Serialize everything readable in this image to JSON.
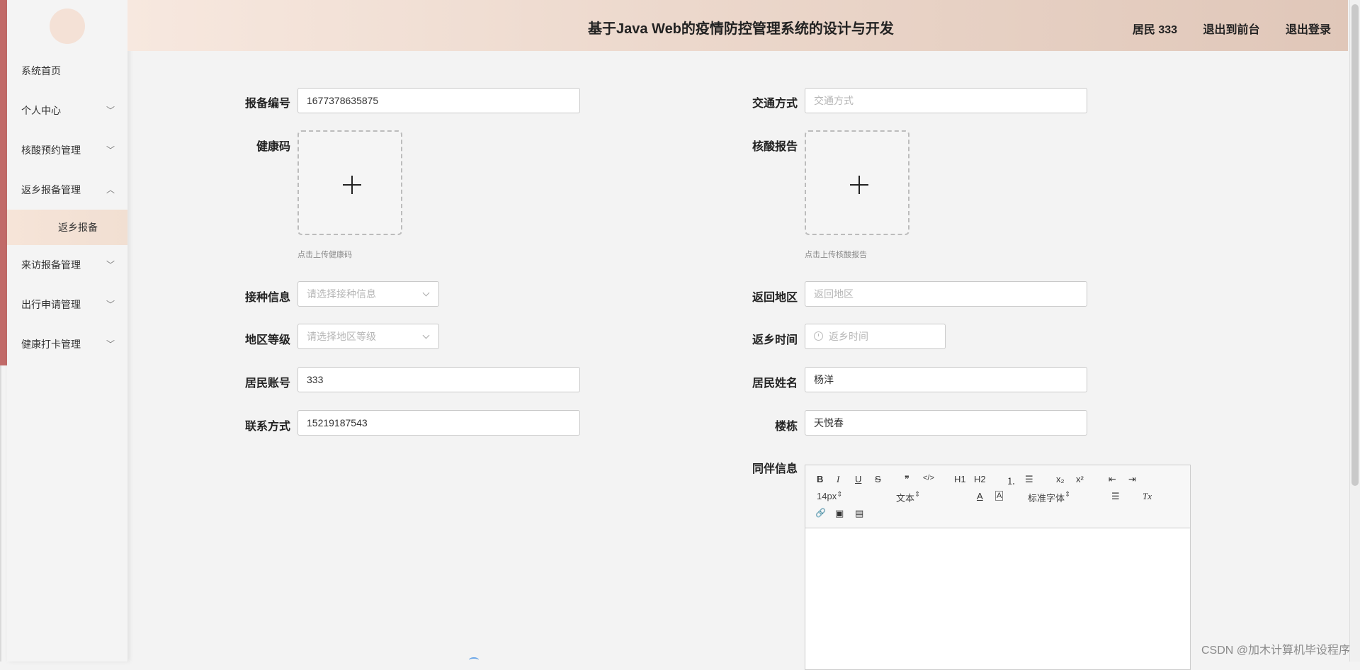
{
  "header": {
    "title": "基于Java Web的疫情防控管理系统的设计与开发",
    "user_label": "居民 333",
    "to_front_label": "退出到前台",
    "logout_label": "退出登录"
  },
  "sidebar": {
    "items": [
      {
        "label": "系统首页"
      },
      {
        "label": "个人中心",
        "chevron": "v"
      },
      {
        "label": "核酸预约管理",
        "chevron": "v"
      },
      {
        "label": "返乡报备管理",
        "chevron": "^",
        "expanded": true
      },
      {
        "label": "来访报备管理",
        "chevron": "v"
      },
      {
        "label": "出行申请管理",
        "chevron": "v"
      },
      {
        "label": "健康打卡管理",
        "chevron": "v"
      }
    ],
    "sub_item": "返乡报备"
  },
  "form": {
    "report_no": {
      "label": "报备编号",
      "value": "1677378635875"
    },
    "transport": {
      "label": "交通方式",
      "placeholder": "交通方式"
    },
    "health_code": {
      "label": "健康码",
      "hint": "点击上传健康码"
    },
    "nucleic_report": {
      "label": "核酸报告",
      "hint": "点击上传核酸报告"
    },
    "vaccination": {
      "label": "接种信息",
      "placeholder": "请选择接种信息"
    },
    "return_region": {
      "label": "返回地区",
      "placeholder": "返回地区"
    },
    "region_level": {
      "label": "地区等级",
      "placeholder": "请选择地区等级"
    },
    "return_time": {
      "label": "返乡时间",
      "placeholder": "返乡时间"
    },
    "resident_account": {
      "label": "居民账号",
      "value": "333"
    },
    "resident_name": {
      "label": "居民姓名",
      "value": "杨洋"
    },
    "contact": {
      "label": "联系方式",
      "value": "15219187543"
    },
    "building": {
      "label": "楼栋",
      "value": "天悦春"
    },
    "companions": {
      "label": "同伴信息"
    }
  },
  "editor_toolbar": {
    "bold": "B",
    "italic": "I",
    "underline": "U",
    "strike": "S",
    "quote": "❞",
    "code": "</>",
    "h1": "H1",
    "h2": "H2",
    "ol": "⒈",
    "ul": "☰",
    "sub": "x₂",
    "sup": "x²",
    "outdent": "⇤",
    "indent": "⇥",
    "size": "14px",
    "header": "文本",
    "color": "A",
    "background": "A",
    "font": "标准字体",
    "align": "☰",
    "clean": "Tx",
    "link": "🔗",
    "image": "▣",
    "video": "▤"
  },
  "watermark": "CSDN @加木计算机毕设程序"
}
